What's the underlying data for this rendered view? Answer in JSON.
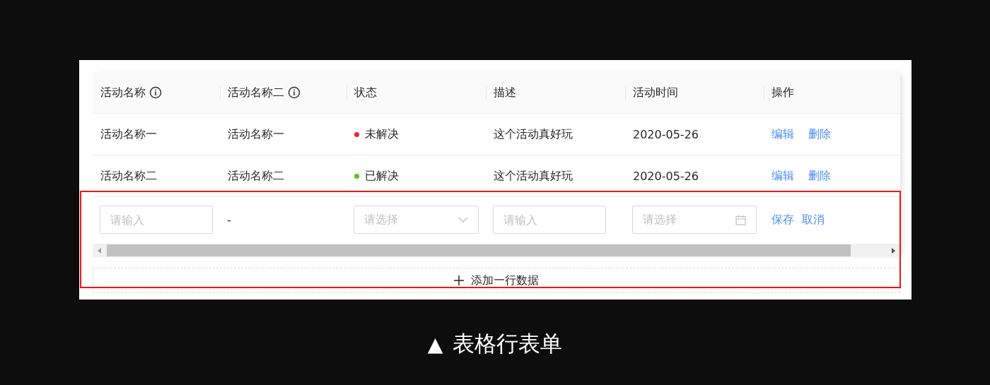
{
  "columns": [
    {
      "label": "活动名称",
      "info": true
    },
    {
      "label": "活动名称二",
      "info": true
    },
    {
      "label": "状态",
      "info": false
    },
    {
      "label": "描述",
      "info": false
    },
    {
      "label": "活动时间",
      "info": false
    },
    {
      "label": "操作",
      "info": false
    }
  ],
  "rows": [
    {
      "name": "活动名称一",
      "name2": "活动名称一",
      "status": {
        "label": "未解决",
        "color": "#f5222d"
      },
      "description": "这个活动真好玩",
      "time": "2020-05-26",
      "actions": [
        "编辑",
        "删除"
      ]
    },
    {
      "name": "活动名称二",
      "name2": "活动名称二",
      "status": {
        "label": "已解决",
        "color": "#52c41a"
      },
      "description": "这个活动真好玩",
      "time": "2020-05-26",
      "actions": [
        "编辑",
        "删除"
      ]
    }
  ],
  "edit_row": {
    "cells": [
      {
        "kind": "input",
        "placeholder": "请输入"
      },
      {
        "kind": "text",
        "text": "-"
      },
      {
        "kind": "select",
        "placeholder": "请选择"
      },
      {
        "kind": "input",
        "placeholder": "请输入"
      },
      {
        "kind": "date",
        "placeholder": "请选择"
      },
      {
        "kind": "actions",
        "actions": [
          "保存",
          "取消"
        ]
      }
    ]
  },
  "add_button": {
    "label": "添加一行数据"
  },
  "caption": {
    "marker": "▲",
    "text": "表格行表单"
  }
}
